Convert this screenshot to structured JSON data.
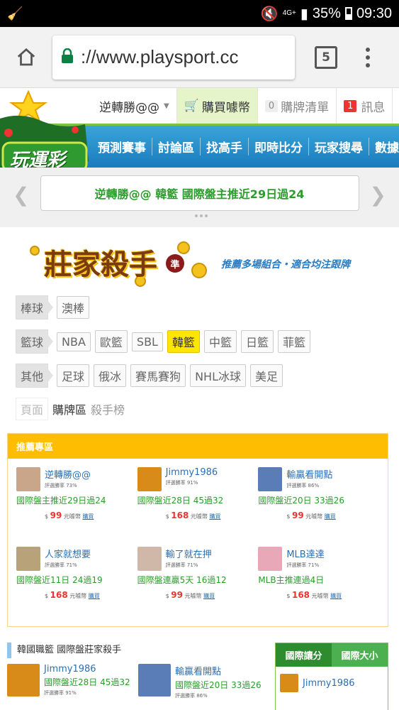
{
  "status_bar": {
    "network": "4G+",
    "battery": "35%",
    "time": "09:30"
  },
  "browser": {
    "url": "://www.playsport.cc",
    "tab_count": "5"
  },
  "userbar": {
    "username": "逆轉勝@@",
    "buy": "購買噱幣",
    "list_count": "0",
    "list_label": "購牌清單",
    "msg_count": "1",
    "msg_label": "訊息"
  },
  "site": {
    "logo_text": "玩運彩"
  },
  "nav": [
    "預測賽事",
    "討論區",
    "找高手",
    "即時比分",
    "玩家搜尋",
    "數據"
  ],
  "carousel": {
    "text_user": "逆轉勝@@",
    "text_rest": "韓籃 國際盤主推近29日過24"
  },
  "banner": {
    "title": "莊家殺手",
    "badge": "準",
    "slogan": "推薦多場組合・適合均注跟牌"
  },
  "categories": {
    "baseball": {
      "head": "棒球",
      "items": [
        "澳棒"
      ]
    },
    "basketball": {
      "head": "籃球",
      "items": [
        "NBA",
        "歐籃",
        "SBL",
        "韓籃",
        "中籃",
        "日籃",
        "菲籃"
      ],
      "active": "韓籃"
    },
    "other": {
      "head": "其他",
      "items": [
        "足球",
        "俄冰",
        "賽馬賽狗",
        "NHL冰球",
        "美足"
      ]
    },
    "page": {
      "head": "頁面",
      "current": "購牌區",
      "other": "殺手榜"
    }
  },
  "recommend": {
    "title": "推薦專區",
    "cards": [
      {
        "name": "逆轉勝@@",
        "rate": "評選勝率 73%",
        "desc": "國際盤主推近29日過24",
        "price": "99",
        "unit": "元噱幣",
        "buy": "購買",
        "avatar_color": "#c9a58a"
      },
      {
        "name": "Jimmy1986",
        "rate": "評選勝率 91%",
        "desc": "國際盤近28日 45過32",
        "price": "168",
        "unit": "元噱幣",
        "buy": "購買",
        "avatar_color": "#d98b1a"
      },
      {
        "name": "輸贏看開點",
        "rate": "評選勝率 86%",
        "desc": "國際盤近20日 33過26",
        "price": "99",
        "unit": "元噱幣",
        "buy": "購買",
        "avatar_color": "#5a7db8"
      },
      {
        "name": "人家就想要",
        "rate": "評選勝率 71%",
        "desc": "國際盤近11日 24過19",
        "price": "168",
        "unit": "元噱幣",
        "buy": "購買",
        "avatar_color": "#b8a27a"
      },
      {
        "name": "輸了就在押",
        "rate": "評選勝率 71%",
        "desc": "國際盤連贏5天 16過12",
        "price": "99",
        "unit": "元噱幣",
        "buy": "購買",
        "avatar_color": "#d0b8a8"
      },
      {
        "name": "MLB達達",
        "rate": "評選勝率 71%",
        "desc": "MLB主推連過4日",
        "price": "168",
        "unit": "元噱幣",
        "buy": "購買",
        "avatar_color": "#e8a8b8"
      }
    ]
  },
  "section": {
    "title": "韓國職籃 國際盤莊家殺手",
    "cards": [
      {
        "name": "Jimmy1986",
        "desc": "國際盤近28日 45過32",
        "rate": "評選勝率 91%",
        "avatar_color": "#d98b1a"
      },
      {
        "name": "輸贏看開點",
        "desc": "國際盤近20日 33過26",
        "rate": "評選勝率 86%",
        "avatar_color": "#5a7db8"
      }
    ],
    "tabs": [
      "國際讓分",
      "國際大小"
    ],
    "side_name": "Jimmy1986"
  },
  "price_prefix": "$"
}
